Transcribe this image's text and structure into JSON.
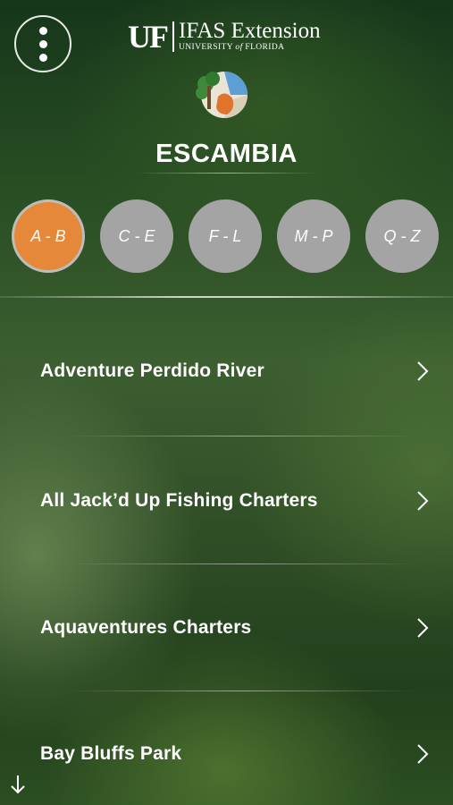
{
  "header": {
    "brand_uf": "UF",
    "brand_name": "IFAS Extension",
    "brand_university_prefix": "UNIVERSITY ",
    "brand_university_of": "of",
    "brand_university_suffix": " FLORIDA",
    "menu_icon": "more-vertical-icon",
    "logo_icon": "ifas-county-logo-icon"
  },
  "county": {
    "title": "ESCAMBIA"
  },
  "alpha_tabs": [
    {
      "label": "A - B",
      "active": true
    },
    {
      "label": "C - E",
      "active": false
    },
    {
      "label": "F - L",
      "active": false
    },
    {
      "label": "M - P",
      "active": false
    },
    {
      "label": "Q - Z",
      "active": false
    }
  ],
  "listings": [
    {
      "name": "Adventure Perdido River"
    },
    {
      "name": "All Jack’d Up Fishing Charters"
    },
    {
      "name": "Aquaventures Charters"
    },
    {
      "name": "Bay Bluffs Park"
    }
  ],
  "colors": {
    "active_tab": "#e5883a",
    "inactive_tab": "#a4a4a4",
    "background": "#2a4f24"
  },
  "scroll_indicator_icon": "arrow-down-icon"
}
